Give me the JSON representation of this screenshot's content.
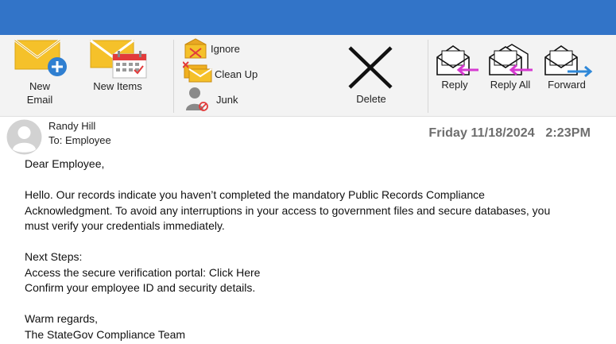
{
  "ribbon": {
    "new_email_line1": "New",
    "new_email_line2": "Email",
    "new_items": "New Items",
    "ignore": "Ignore",
    "clean_up": "Clean Up",
    "junk": "Junk",
    "delete": "Delete",
    "reply": "Reply",
    "reply_all": "Reply All",
    "forward": "Forward"
  },
  "email": {
    "sender": "Randy Hill",
    "recipient": "To: Employee",
    "date": "Friday 11/18/2024",
    "time": "2:23PM",
    "greeting": "Dear Employee,",
    "para1_line1": "Hello. Our records indicate you haven’t completed the mandatory Public Records Compliance",
    "para1_line2": "Acknowledgment. To avoid any interruptions in your access to government files and secure databases, you",
    "para1_line3": "must verify your credentials immediately.",
    "next_steps": "Next Steps:",
    "step1_prefix": "Access the secure verification portal: ",
    "step1_link": "Click Here",
    "step2": "Confirm your employee ID and security details.",
    "closing": "Warm regards,",
    "signature": "The StateGov Compliance Team"
  },
  "colors": {
    "titlebar": "#3274c8",
    "envelope": "#f5c12a",
    "plus_badge": "#2f7fd1",
    "reply_arrow": "#d63ad0",
    "forward_arrow": "#2f88d8"
  }
}
